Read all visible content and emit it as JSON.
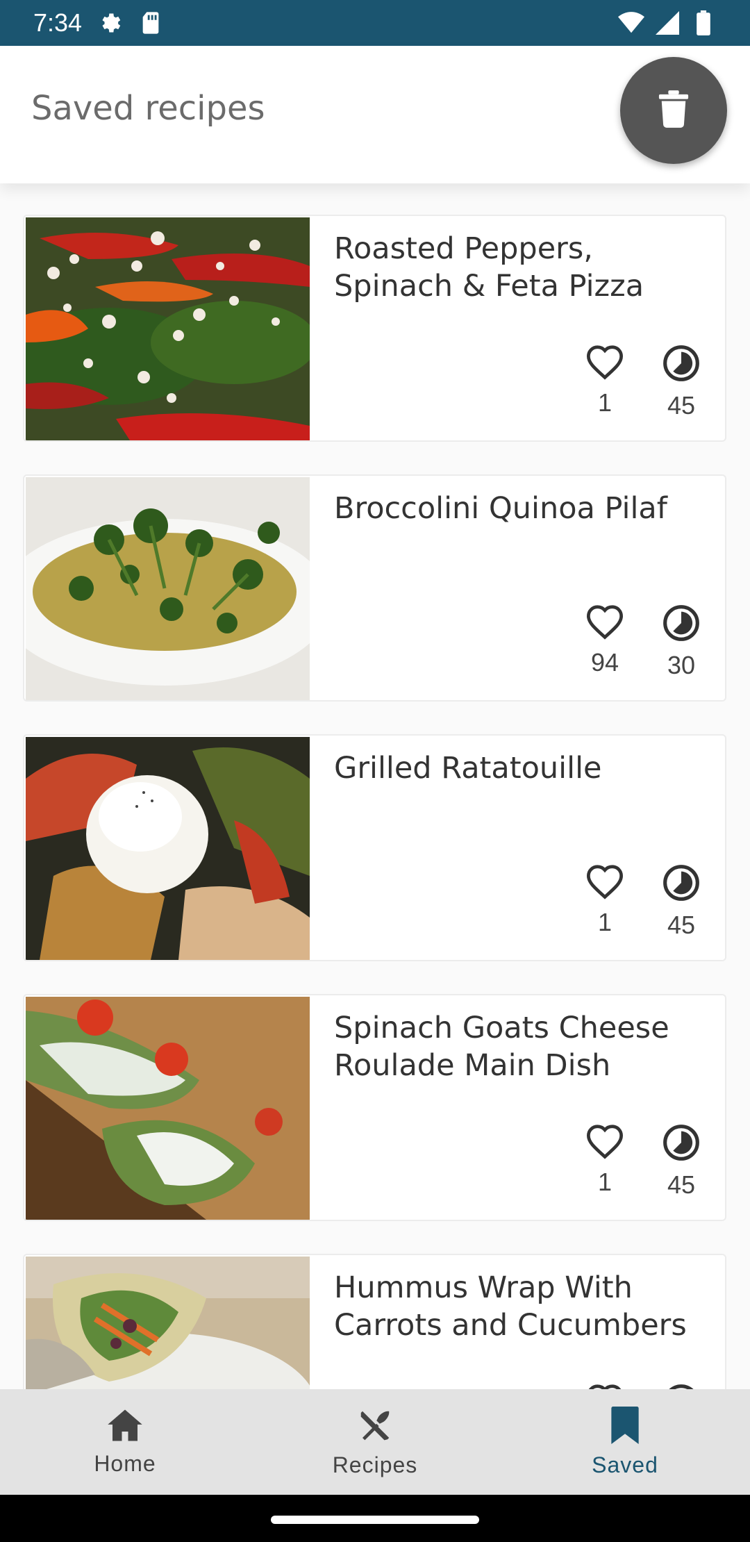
{
  "status_bar": {
    "time": "7:34",
    "icons_left": [
      "settings-icon",
      "sd-card-icon"
    ],
    "icons_right": [
      "wifi-icon",
      "signal-icon",
      "battery-icon"
    ],
    "background": "#1b5570"
  },
  "header": {
    "title": "Saved recipes",
    "fab_icon": "trash-icon"
  },
  "recipes": [
    {
      "title": "Roasted Peppers, Spinach & Feta Pizza",
      "likes": "1",
      "time": "45"
    },
    {
      "title": "Broccolini Quinoa Pilaf",
      "likes": "94",
      "time": "30"
    },
    {
      "title": "Grilled Ratatouille",
      "likes": "1",
      "time": "45"
    },
    {
      "title": "Spinach Goats Cheese Roulade Main Dish",
      "likes": "1",
      "time": "45"
    },
    {
      "title": "Hummus Wrap With Carrots and Cucumbers",
      "likes": "",
      "time": ""
    }
  ],
  "bottom_nav": {
    "items": [
      {
        "label": "Home",
        "icon": "home-icon",
        "active": false
      },
      {
        "label": "Recipes",
        "icon": "utensils-icon",
        "active": false
      },
      {
        "label": "Saved",
        "icon": "bookmark-icon",
        "active": true
      }
    ],
    "active_color": "#1b5570"
  }
}
